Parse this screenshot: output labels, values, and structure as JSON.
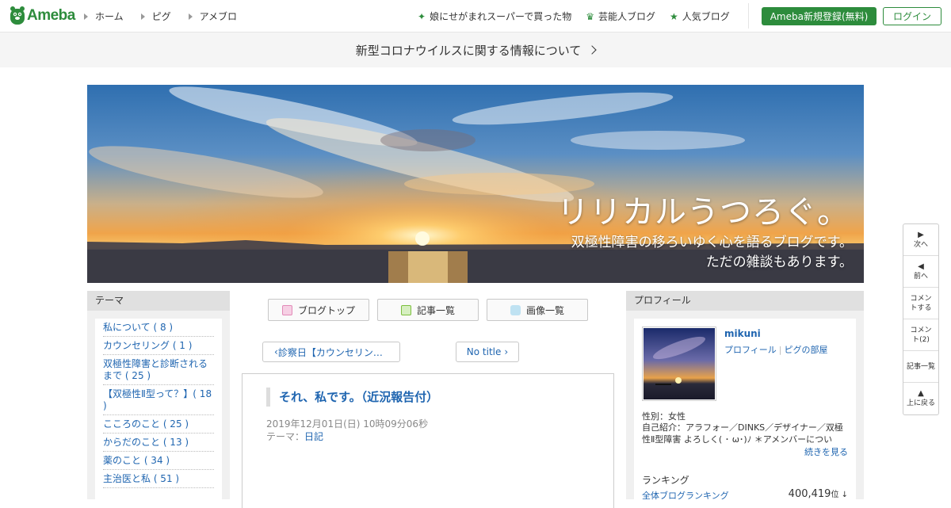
{
  "header": {
    "logo_text": "Ameba",
    "nav": [
      "ホーム",
      "ピグ",
      "アメブロ"
    ],
    "right_links": [
      {
        "icon": "sparkle-icon",
        "label": "娘にせがまれスーパーで買った物"
      },
      {
        "icon": "crown-icon",
        "label": "芸能人ブログ"
      },
      {
        "icon": "star-icon",
        "label": "人気ブログ"
      }
    ],
    "register_label": "Ameba新規登録(無料)",
    "login_label": "ログイン",
    "accent_color": "#2d8c3c"
  },
  "notice": {
    "text": "新型コロナウイルスに関する情報について"
  },
  "blog": {
    "title": "リリカルうつろぐ。",
    "subtitle_line1": "双極性障害の移ろいゆく心を語るブログです。",
    "subtitle_line2": "ただの雑談もあります。"
  },
  "theme": {
    "heading": "テーマ",
    "items": [
      "私について ( 8 )",
      "カウンセリング ( 1 )",
      "双極性障害と診断されるまで ( 25 )",
      "【双極性Ⅱ型って？】( 18 )",
      "こころのこと ( 25 )",
      "からだのこと ( 13 )",
      "薬のこと ( 34 )",
      "主治医と私 ( 51 )"
    ]
  },
  "tabs": [
    {
      "icon": "document-icon",
      "label": "ブログトップ"
    },
    {
      "icon": "list-icon",
      "label": "記事一覧"
    },
    {
      "icon": "camera-icon",
      "label": "画像一覧"
    }
  ],
  "pager": {
    "prev": "診察日【カウンセリン…",
    "next": "No title"
  },
  "article": {
    "title": "それ、私です。（近況報告付）",
    "date": "2019年12月01日(日) 10時09分06秒",
    "theme_label": "テーマ：",
    "theme_value": "日記"
  },
  "profile": {
    "heading": "プロフィール",
    "name": "mikuni",
    "link_profile": "プロフィール",
    "link_room": "ピグの部屋",
    "gender": "性別：女性",
    "intro": "自己紹介：アラフォー／DINKS／デザイナー／双極性Ⅱ型障害 よろしく( ･ ω･)ﾉ ＊アメンバーについて…",
    "more": "続きを見る",
    "ranking_heading": "ランキング",
    "ranking_link": "全体ブログランキング",
    "ranking_value": "400,419",
    "ranking_unit": "位 ↓"
  },
  "floatnav": [
    {
      "icon": "▶",
      "label": "次へ"
    },
    {
      "icon": "◀",
      "label": "前へ"
    },
    {
      "icon": "",
      "label": "コメントする"
    },
    {
      "icon": "",
      "label": "コメント(2)"
    },
    {
      "icon": "",
      "label": "記事一覧"
    },
    {
      "icon": "▲",
      "label": "上に戻る"
    }
  ]
}
